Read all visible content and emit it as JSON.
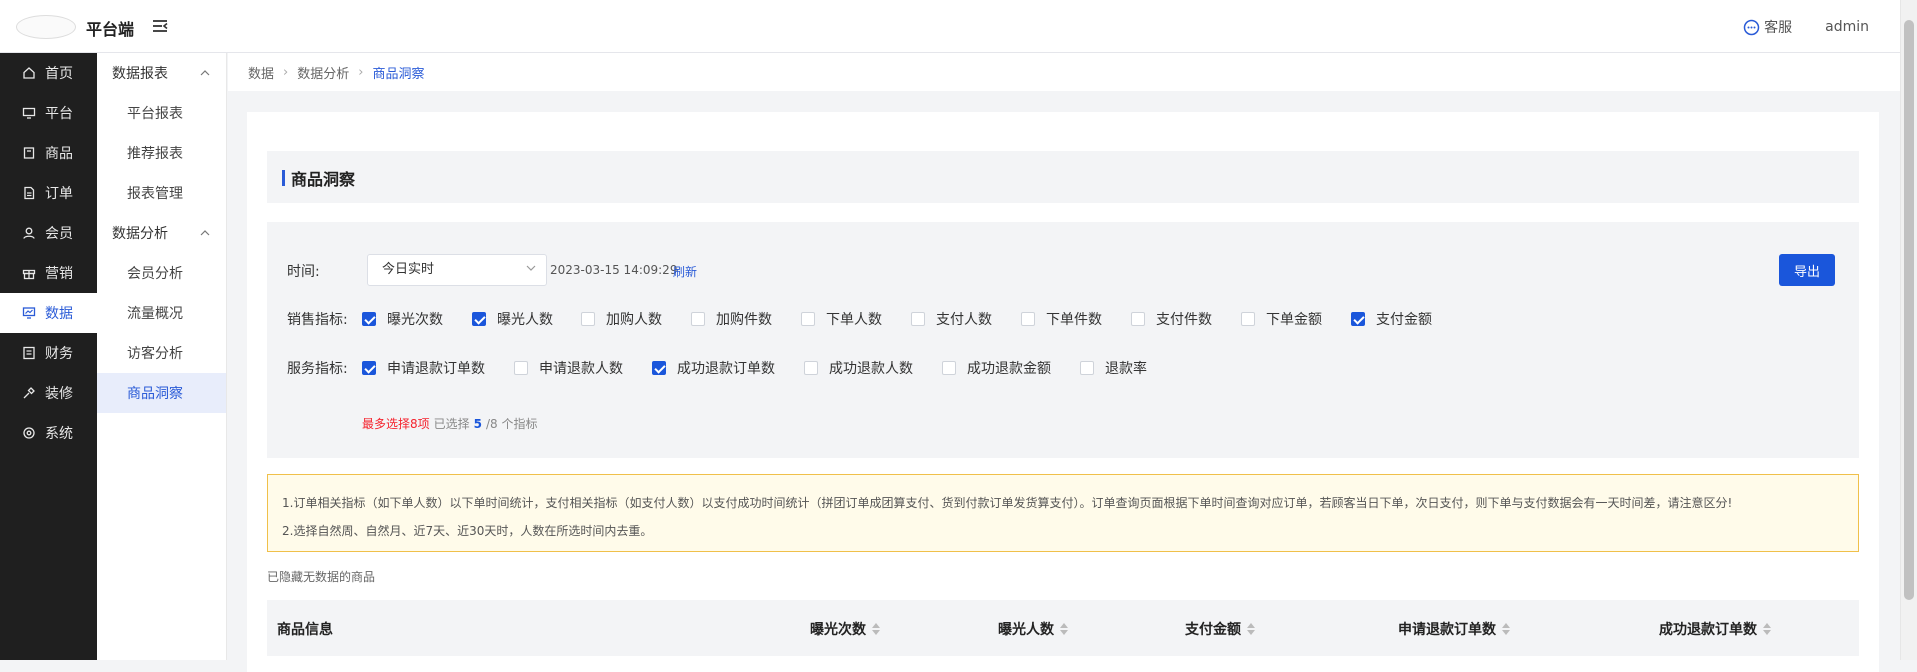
{
  "header": {
    "app_title": "平台端",
    "service_label": "客服",
    "user": "admin"
  },
  "sidebar": {
    "items": [
      {
        "label": "首页",
        "icon": "home-icon"
      },
      {
        "label": "平台",
        "icon": "monitor-icon"
      },
      {
        "label": "商品",
        "icon": "goods-icon"
      },
      {
        "label": "订单",
        "icon": "order-icon"
      },
      {
        "label": "会员",
        "icon": "member-icon"
      },
      {
        "label": "营销",
        "icon": "gift-icon"
      },
      {
        "label": "数据",
        "icon": "data-icon",
        "active": true
      },
      {
        "label": "财务",
        "icon": "finance-icon"
      },
      {
        "label": "装修",
        "icon": "decorate-icon"
      },
      {
        "label": "系统",
        "icon": "settings-icon"
      }
    ]
  },
  "subnav": {
    "group1": "数据报表",
    "group1_items": [
      "平台报表",
      "推荐报表",
      "报表管理"
    ],
    "group2": "数据分析",
    "group2_items": [
      "会员分析",
      "流量概况",
      "访客分析",
      "商品洞察"
    ]
  },
  "breadcrumb": [
    "数据",
    "数据分析",
    "商品洞察"
  ],
  "page": {
    "title": "商品洞察"
  },
  "filter": {
    "time_label": "时间:",
    "time_value": "今日实时",
    "datetime": "2023-03-15 14:09:29",
    "refresh": "刷新",
    "export": "导出",
    "sales_label": "销售指标:",
    "sales_metrics": [
      {
        "label": "曝光次数",
        "checked": true
      },
      {
        "label": "曝光人数",
        "checked": true
      },
      {
        "label": "加购人数",
        "checked": false
      },
      {
        "label": "加购件数",
        "checked": false
      },
      {
        "label": "下单人数",
        "checked": false
      },
      {
        "label": "支付人数",
        "checked": false
      },
      {
        "label": "下单件数",
        "checked": false
      },
      {
        "label": "支付件数",
        "checked": false
      },
      {
        "label": "下单金额",
        "checked": false
      },
      {
        "label": "支付金额",
        "checked": true
      }
    ],
    "service_label": "服务指标:",
    "service_metrics": [
      {
        "label": "申请退款订单数",
        "checked": true
      },
      {
        "label": "申请退款人数",
        "checked": false
      },
      {
        "label": "成功退款订单数",
        "checked": true
      },
      {
        "label": "成功退款人数",
        "checked": false
      },
      {
        "label": "成功退款金额",
        "checked": false
      },
      {
        "label": "退款率",
        "checked": false
      }
    ],
    "hint_max": "最多选择8项",
    "hint_selected_prefix": "已选择",
    "hint_count": "5",
    "hint_suffix": "/8 个指标"
  },
  "notice": {
    "line1": "1.订单相关指标（如下单人数）以下单时间统计，支付相关指标（如支付人数）以支付成功时间统计（拼团订单成团算支付、货到付款订单发货算支付）。订单查询页面根据下单时间查询对应订单，若顾客当日下单，次日支付，则下单与支付数据会有一天时间差，请注意区分!",
    "line2": "2.选择自然周、自然月、近7天、近30天时，人数在所选时间内去重。"
  },
  "hidden_note": "已隐藏无数据的商品",
  "table": {
    "headers": [
      "商品信息",
      "曝光次数",
      "曝光人数",
      "支付金额",
      "申请退款订单数",
      "成功退款订单数"
    ]
  }
}
